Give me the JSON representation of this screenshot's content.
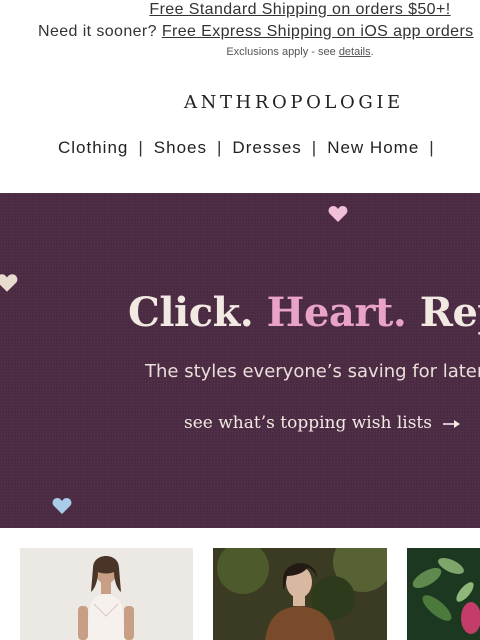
{
  "shipping": {
    "line1": "Free Standard Shipping on orders $50+!",
    "line2_prefix": "Need it sooner? ",
    "line2_link": "Free Express Shipping on iOS app orders",
    "exclusions_prefix": "Exclusions apply - see ",
    "exclusions_link": "details",
    "exclusions_suffix": "."
  },
  "brand": {
    "logo": "ANTHROPOLOGIE"
  },
  "nav": {
    "items": [
      "Clothing",
      "Shoes",
      "Dresses",
      "New Home"
    ],
    "separator": "|"
  },
  "hero": {
    "title_part1": "Click. ",
    "title_part2": "Heart.",
    "title_part3": " Repeat.",
    "subtitle": "The styles everyone’s saving for later.",
    "cta": "see what’s topping wish lists",
    "background": "#4a2a42",
    "accent_pink": "#e9a3c7"
  },
  "products": [
    {
      "name": "product-card-white-top"
    },
    {
      "name": "product-card-brown-jacket"
    },
    {
      "name": "product-card-botanical"
    }
  ]
}
